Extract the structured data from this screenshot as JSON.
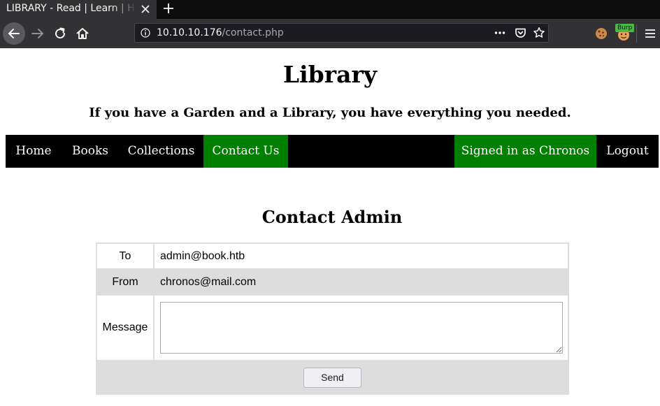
{
  "browser": {
    "tab_title": "LIBRARY - Read | Learn | Have Fun",
    "url_host": "10.10.10.176",
    "url_path": "/contact.php",
    "burp_badge": "Burp"
  },
  "site": {
    "title": "Library",
    "tagline": "If you have a Garden and a Library, you have everything you needed."
  },
  "nav": {
    "home": "Home",
    "books": "Books",
    "collections": "Collections",
    "contact": "Contact Us",
    "signed_in": "Signed in as Chronos",
    "logout": "Logout",
    "active_color": "#008000"
  },
  "contact": {
    "heading": "Contact Admin",
    "to_label": "To",
    "to_value": "admin@book.htb",
    "from_label": "From",
    "from_value": "chronos@mail.com",
    "message_label": "Message",
    "message_value": "",
    "send_label": "Send"
  },
  "icons": {
    "tab_close": "close-icon",
    "new_tab": "plus-icon",
    "back": "arrow-left-icon",
    "forward": "arrow-right-icon",
    "reload": "reload-icon",
    "home": "home-icon",
    "site_info": "info-icon",
    "page_actions": "more-horizontal-icon",
    "pocket": "pocket-icon",
    "bookmark": "star-icon",
    "cookie_ext": "cookie-icon",
    "burp_ext": "burp-icon",
    "menu": "hamburger-menu-icon"
  }
}
